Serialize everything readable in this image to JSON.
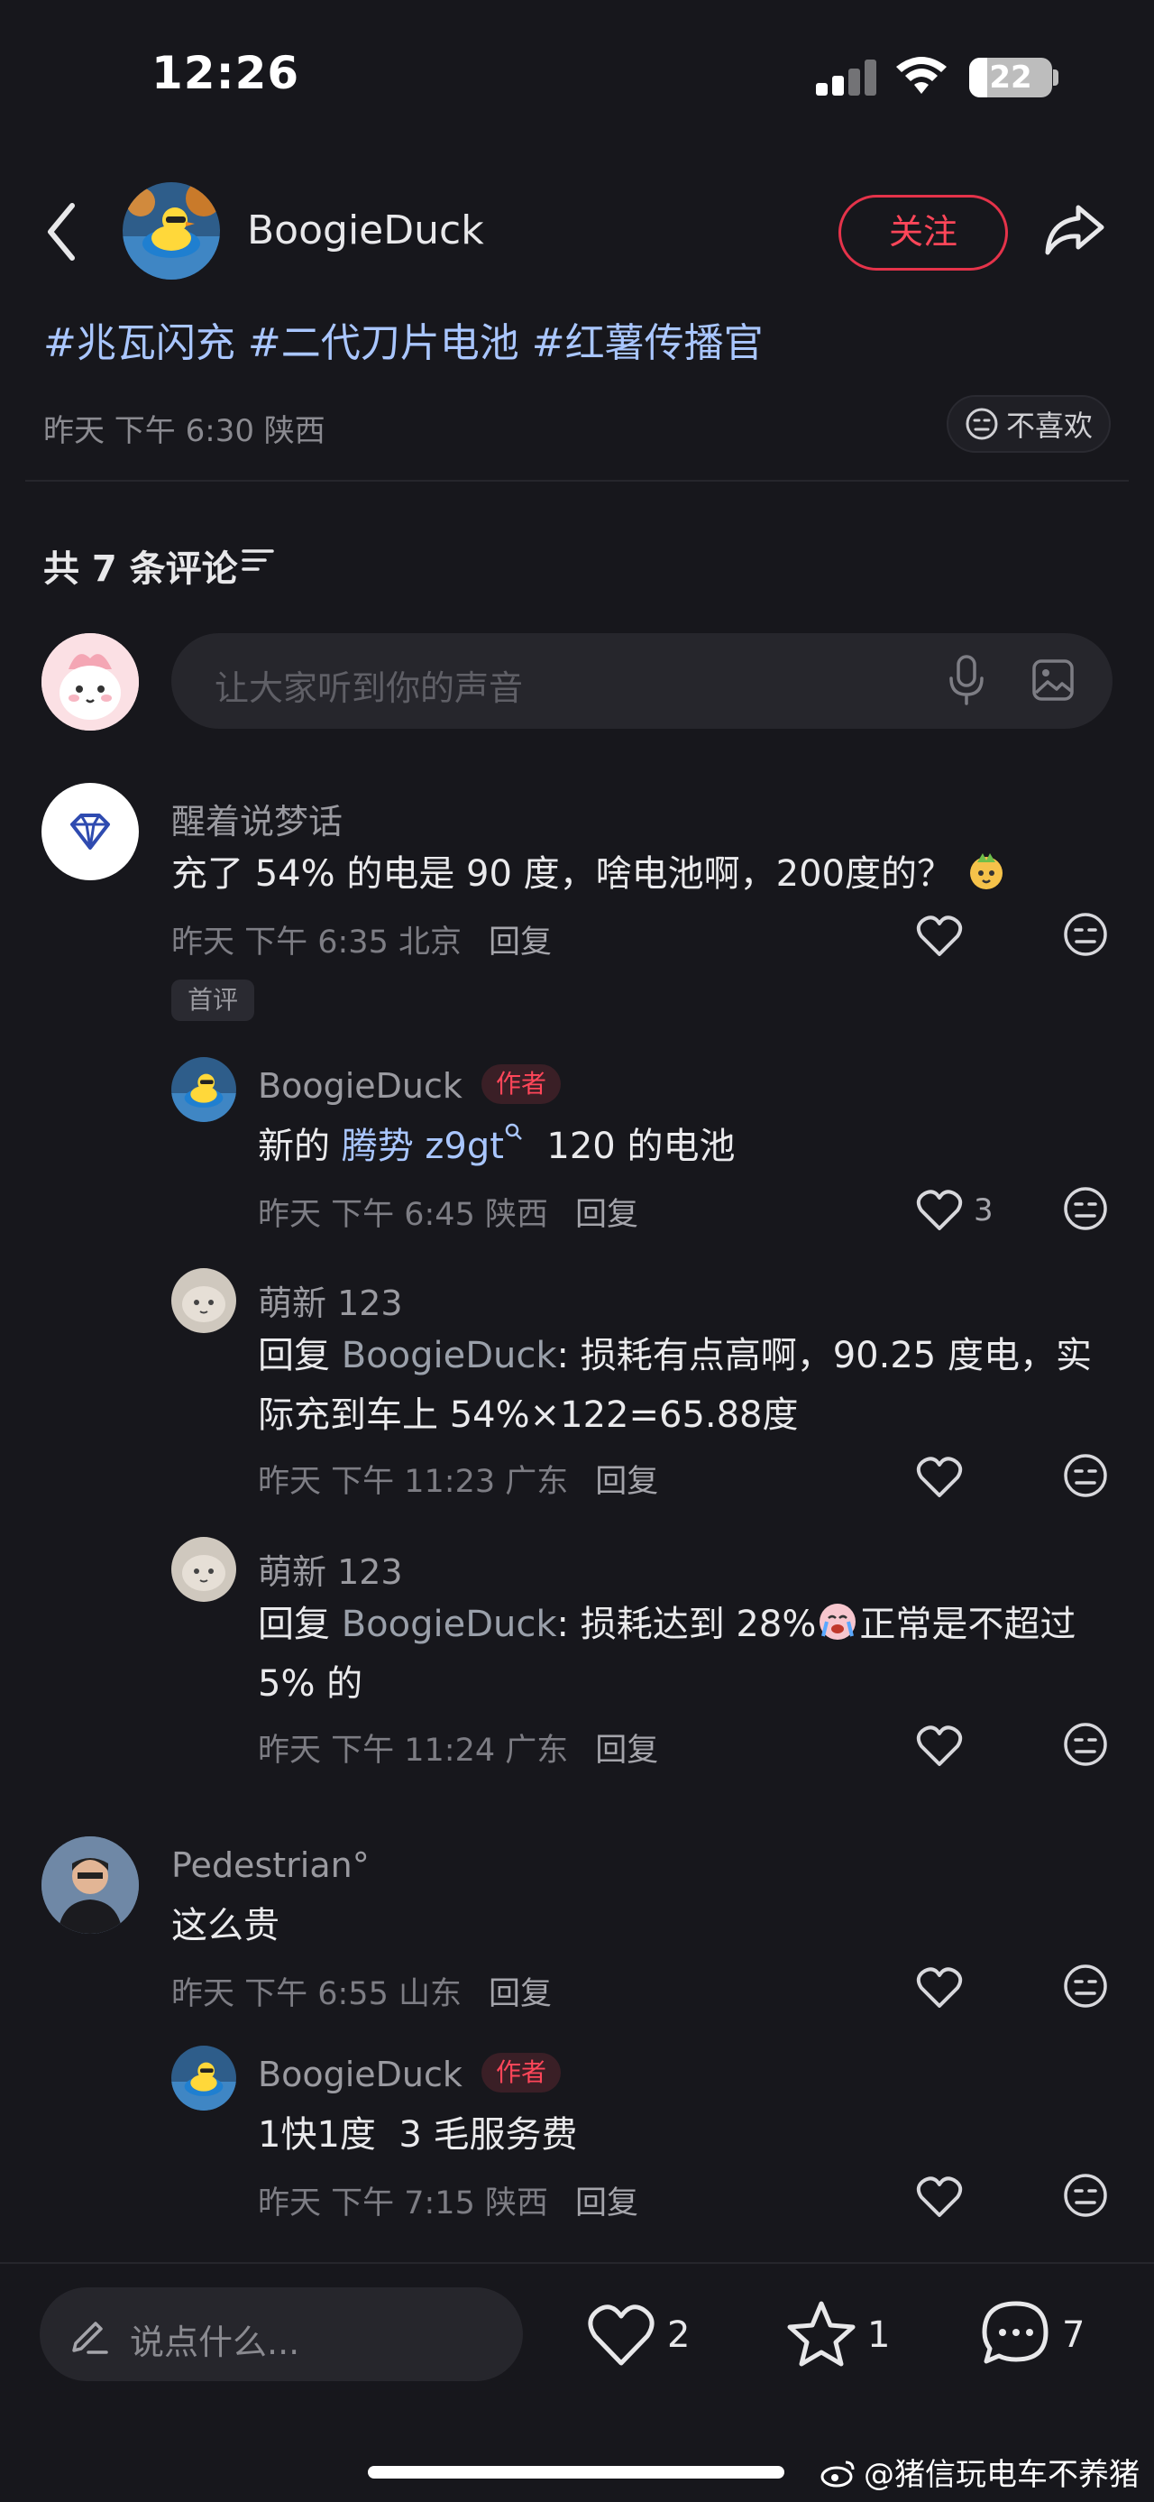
{
  "status": {
    "time": "12:26",
    "battery": "22",
    "battery_level": 0.22
  },
  "header": {
    "author_name": "BoogieDuck",
    "follow_label": "关注"
  },
  "post": {
    "hashtags": [
      "#兆瓦闪充",
      "#二代刀片电池",
      "#红薯传播官"
    ],
    "meta": "昨天 下午 6:30 陕西",
    "dislike_label": "不喜欢"
  },
  "comments_header": {
    "count_label": "共 7 条评论",
    "input_placeholder": "让大家听到你的声音"
  },
  "comments": [
    {
      "name": "醒着说梦话",
      "text": "充了 54% 的电是 90 度，啥电池啊，200度的？",
      "meta": "昨天 下午 6:35 北京",
      "reply_label": "回复",
      "badge": "首评",
      "replies": [
        {
          "name": "BoogieDuck",
          "badge": "作者",
          "text_prefix": "新的 ",
          "link_text": "腾势 z9gt",
          "text_suffix": "  120 的电池",
          "meta": "昨天 下午 6:45 陕西",
          "reply_label": "回复",
          "likes": "3"
        },
        {
          "name": "萌新 123",
          "text_prefix": "回复 ",
          "mention": "BoogieDuck",
          "line1": ": 损耗有点高啊，90.25 度电，实",
          "line2": "际充到车上 54%×122=65.88度",
          "meta": "昨天 下午 11:23 广东",
          "reply_label": "回复"
        },
        {
          "name": "萌新 123",
          "text_prefix": "回复 ",
          "mention": "BoogieDuck",
          "line1": ": 损耗达到 28%",
          "line1b": "正常是不超过",
          "line2": "5% 的",
          "meta": "昨天 下午 11:24 广东",
          "reply_label": "回复"
        }
      ]
    },
    {
      "name": "Pedestrian°",
      "text": "这么贵",
      "meta": "昨天 下午 6:55 山东",
      "reply_label": "回复",
      "replies": [
        {
          "name": "BoogieDuck",
          "badge": "作者",
          "text": "1快1度  3 毛服务费",
          "meta": "昨天 下午 7:15 陕西",
          "reply_label": "回复"
        }
      ]
    }
  ],
  "bottom_bar": {
    "placeholder": "说点什么...",
    "likes": "2",
    "stars": "1",
    "comments": "7"
  },
  "watermark": "@猪信玩电车不养猪",
  "colors": {
    "accent": "#ff4659",
    "link": "#a9c6ff",
    "background": "#17171c"
  }
}
